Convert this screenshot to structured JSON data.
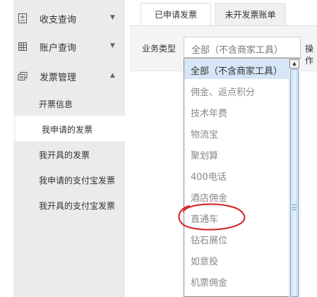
{
  "sidebar": {
    "items": [
      {
        "label": "收支查询",
        "icon": "doc-plus-icon",
        "caret": "▼"
      },
      {
        "label": "账户查询",
        "icon": "grid-icon",
        "caret": "▼"
      },
      {
        "label": "发票管理",
        "icon": "invoice-stack-icon",
        "caret": "▲"
      }
    ],
    "sub_items": [
      {
        "label": "开票信息"
      },
      {
        "label": "我申请的发票",
        "active": true
      },
      {
        "label": "我开具的发票"
      },
      {
        "label": "我申请的支付宝发票"
      },
      {
        "label": "我开具的支付宝发票"
      }
    ]
  },
  "tabs": [
    {
      "label": "已申请发票",
      "active": true
    },
    {
      "label": "未开发票账单",
      "active": false
    }
  ],
  "filter": {
    "business_type_label": "业务类型",
    "selected_value": "全部（不含商家工具）",
    "operation_label": "操作"
  },
  "dropdown": {
    "options": [
      "全部（不含商家工具）",
      "佣金、返点积分",
      "技术年费",
      "物流宝",
      "聚划算",
      "400电话",
      "酒店佣金",
      "直通车",
      "钻石展位",
      "如意投",
      "机票佣金"
    ],
    "selected_index": 0,
    "highlighted_option": "直通车",
    "annotation_color": "#d62c2c"
  },
  "colors": {
    "sidebar_bg": "#ebebeb",
    "selected_option_bg": "#d6e6f7",
    "scroll_thumb": "#cfe2f6"
  }
}
